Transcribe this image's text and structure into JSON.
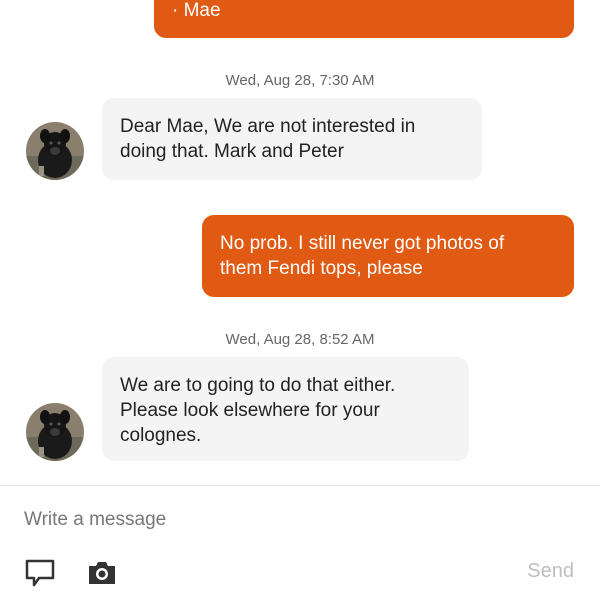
{
  "conversation": {
    "messages": [
      {
        "direction": "outgoing",
        "lines": [
          "· Mae"
        ]
      },
      {
        "direction": "incoming",
        "timestamp": "Wed, Aug 28, 7:30 AM",
        "lines": [
          "Dear Mae,  We are not interested in",
          "doing that.  Mark and Peter"
        ]
      },
      {
        "direction": "outgoing",
        "lines": [
          "No prob. I still never got photos of",
          "them Fendi tops, please"
        ]
      },
      {
        "direction": "incoming",
        "timestamp": "Wed, Aug 28, 8:52 AM",
        "lines": [
          "We are to going to do that either.",
          "Please look elsewhere for your",
          "colognes."
        ]
      }
    ]
  },
  "composer": {
    "placeholder": "Write a message",
    "send_label": "Send",
    "icons": [
      "message-flag-icon",
      "camera-icon"
    ]
  },
  "colors": {
    "outgoing_bubble": "#e05a14",
    "incoming_bubble": "#f4f4f4",
    "send_disabled": "#bdbdbd"
  }
}
